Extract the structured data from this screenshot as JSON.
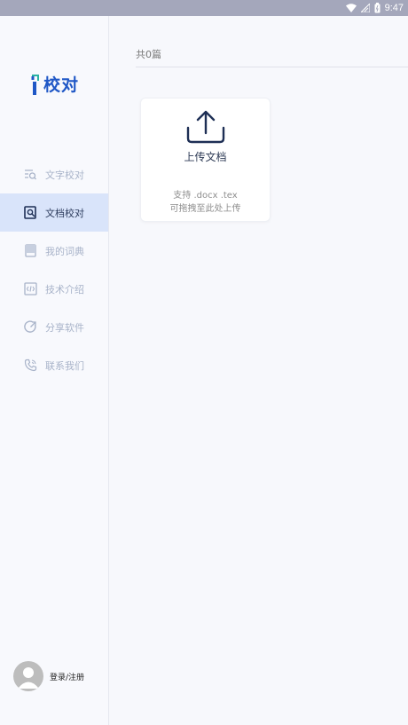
{
  "status_bar": {
    "time": "9:47"
  },
  "app": {
    "logo_text": "校对"
  },
  "sidebar": {
    "items": [
      {
        "label": "文字校对",
        "icon": "text-search-icon",
        "active": false
      },
      {
        "label": "文档校对",
        "icon": "document-search-icon",
        "active": true
      },
      {
        "label": "我的词典",
        "icon": "book-icon",
        "active": false
      },
      {
        "label": "技术介绍",
        "icon": "code-icon",
        "active": false
      },
      {
        "label": "分享软件",
        "icon": "share-icon",
        "active": false
      },
      {
        "label": "联系我们",
        "icon": "phone-icon",
        "active": false
      }
    ],
    "login_label": "登录/注册"
  },
  "main": {
    "count_text": "共0篇",
    "upload": {
      "title": "上传文档",
      "support_text": "支持 .docx .tex",
      "drag_text": "可拖拽至此处上传"
    }
  },
  "colors": {
    "accent": "#1f57c6",
    "active_bg": "#d9e4fa",
    "status_bar": "#a4a7bb"
  }
}
